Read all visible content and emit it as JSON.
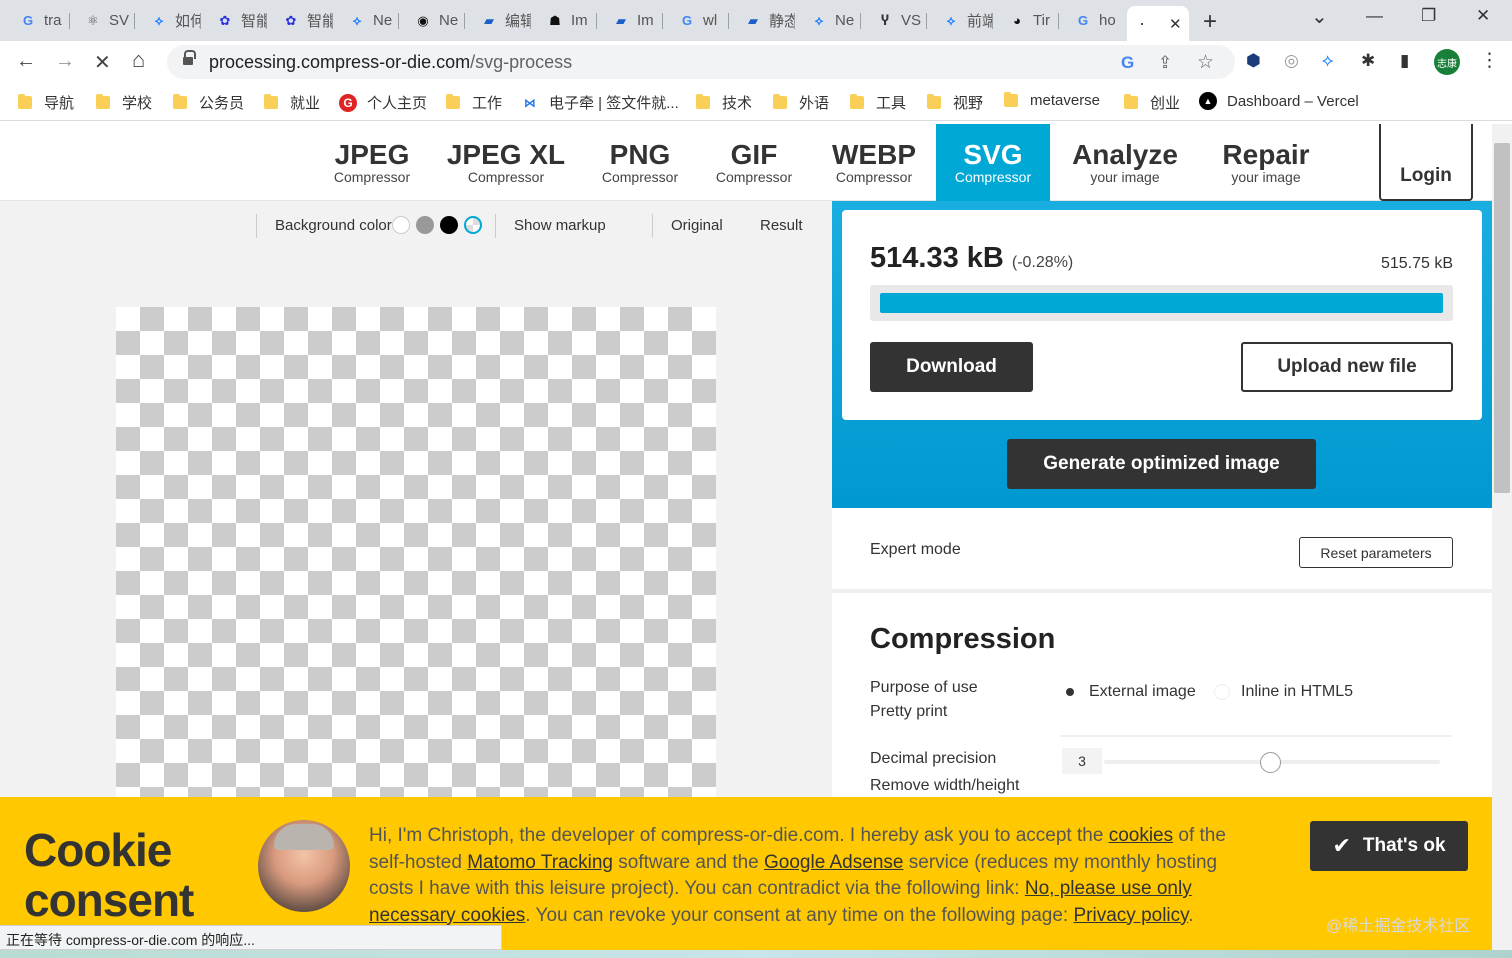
{
  "browser": {
    "tabs": [
      {
        "icon": "G",
        "label": "tra"
      },
      {
        "icon": "⚛",
        "label": "SV"
      },
      {
        "icon": "⟡",
        "label": "如何"
      },
      {
        "icon": "✿",
        "label": "智能"
      },
      {
        "icon": "✿",
        "label": "智能"
      },
      {
        "icon": "⟡",
        "label": "Ne"
      },
      {
        "icon": "◉",
        "label": "Ne"
      },
      {
        "icon": "▰",
        "label": "编辑"
      },
      {
        "icon": "☗",
        "label": "Im"
      },
      {
        "icon": "▰",
        "label": "Im"
      },
      {
        "icon": "G",
        "label": "wl"
      },
      {
        "icon": "▰",
        "label": "静态"
      },
      {
        "icon": "⟡",
        "label": "Ne"
      },
      {
        "icon": "Ⴤ",
        "label": "VS"
      },
      {
        "icon": "⟡",
        "label": "前端"
      },
      {
        "icon": "◕",
        "label": "Tir"
      },
      {
        "icon": "G",
        "label": "ho"
      }
    ],
    "active_tab": {
      "loading_glyph": "·",
      "close": "✕"
    },
    "new_tab": "+",
    "window_controls": {
      "dropdown": "⌄",
      "minimize": "—",
      "maximize": "❐",
      "close": "✕"
    },
    "nav": {
      "back": "←",
      "forward": "→",
      "stop": "✕",
      "home": "⌂"
    },
    "url_host": "processing.compress-or-die.com",
    "url_path": "/svg-process",
    "omnibox_icons": {
      "google": "G",
      "share": "⇪",
      "star": "☆"
    },
    "extension_icons": {
      "ext1": "⬢",
      "ext2": "◎",
      "ext3": "⟡",
      "puzzle": "✱",
      "sidepanel": "▮"
    },
    "profile_label": "志康",
    "menu": "⋮",
    "bookmarks": [
      {
        "type": "folder",
        "label": "导航"
      },
      {
        "type": "folder",
        "label": "学校"
      },
      {
        "type": "folder",
        "label": "公务员"
      },
      {
        "type": "folder",
        "label": "就业"
      },
      {
        "type": "icon",
        "icon": "G",
        "color": "#e02424",
        "label": "个人主页"
      },
      {
        "type": "folder",
        "label": "工作"
      },
      {
        "type": "icon",
        "icon": "⋈",
        "color": "#1a73e8",
        "label": "电子牵 | 签文件就..."
      },
      {
        "type": "folder",
        "label": "技术"
      },
      {
        "type": "folder",
        "label": "外语"
      },
      {
        "type": "folder",
        "label": "工具"
      },
      {
        "type": "folder",
        "label": "视野"
      },
      {
        "type": "folder",
        "label": "metaverse"
      },
      {
        "type": "folder",
        "label": "创业"
      },
      {
        "type": "icon",
        "icon": "▲",
        "color": "#000000",
        "label": "Dashboard – Vercel"
      }
    ]
  },
  "site": {
    "nav": [
      {
        "big": "JPEG",
        "small": "Compressor"
      },
      {
        "big": "JPEG XL",
        "small": "Compressor"
      },
      {
        "big": "PNG",
        "small": "Compressor"
      },
      {
        "big": "GIF",
        "small": "Compressor"
      },
      {
        "big": "WEBP",
        "small": "Compressor"
      },
      {
        "big": "SVG",
        "small": "Compressor"
      },
      {
        "big": "Analyze",
        "small": "your image"
      },
      {
        "big": "Repair",
        "small": "your image"
      }
    ],
    "login": "Login",
    "accent": "#00a8d6"
  },
  "viewbar": {
    "bg_label": "Background color",
    "swatches": [
      "#ffffff",
      "#999999",
      "#000000",
      "checker"
    ],
    "show_markup": "Show markup",
    "original": "Original",
    "result": "Result"
  },
  "result": {
    "size": "514.33 kB",
    "change": "(-0.28%)",
    "original_size": "515.75 kB",
    "progress": 1.0,
    "download": "Download",
    "upload": "Upload new file",
    "generate": "Generate optimized image"
  },
  "expert": {
    "label": "Expert mode",
    "reset": "Reset parameters"
  },
  "compression": {
    "title": "Compression",
    "purpose_label": "Purpose of use",
    "pretty_print": "Pretty print",
    "options": [
      {
        "label": "External image",
        "selected": true
      },
      {
        "label": "Inline in HTML5",
        "selected": false
      }
    ],
    "decimal_label": "Decimal precision",
    "decimal_value": "3",
    "remove_wh": "Remove width/height"
  },
  "cookie": {
    "title_line1": "Cookie",
    "title_line2": "consent",
    "text_1": "Hi, I'm Christoph, the developer of compress-or-die.com. I hereby ask you to accept the ",
    "link_cookies": "cookies",
    "text_2": " of the self-hosted ",
    "link_matomo": "Matomo Tracking",
    "text_3": " software and the ",
    "link_adsense": "Google Adsense",
    "text_4": " service (reduces my monthly hosting costs I have with this leisure project). You can contradict via the following link: ",
    "link_no": "No, please use only necessary cookies",
    "text_5": ". You can revoke your consent at any time on the following page: ",
    "link_privacy": "Privacy policy",
    "text_6": ".",
    "ok": "That's ok",
    "ok_icon": "✔"
  },
  "status_text": "正在等待 compress-or-die.com 的响应...",
  "watermark": "@稀土掘金技术社区"
}
